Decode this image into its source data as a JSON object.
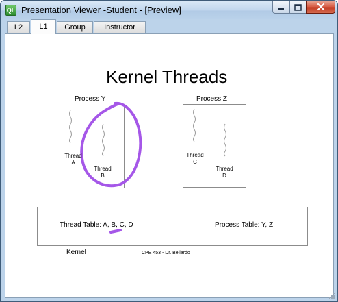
{
  "window": {
    "title": "Presentation Viewer -Student - [Preview]",
    "icon_glyph": "QL"
  },
  "tabs": [
    {
      "label": "L2",
      "active": false
    },
    {
      "label": "L1",
      "active": true
    },
    {
      "label": "Group",
      "active": false
    },
    {
      "label": "Instructor",
      "active": false
    }
  ],
  "slide": {
    "title": "Kernel Threads",
    "process_y": {
      "label": "Process Y",
      "threads": [
        {
          "line1": "Thread",
          "line2": "A"
        },
        {
          "line1": "Thread",
          "line2": "B"
        }
      ]
    },
    "process_z": {
      "label": "Process Z",
      "threads": [
        {
          "line1": "Thread",
          "line2": "C"
        },
        {
          "line1": "Thread",
          "line2": "D"
        }
      ]
    },
    "kernel": {
      "label": "Kernel",
      "thread_table": "Thread Table: A, B, C, D",
      "process_table": "Process Table: Y, Z"
    },
    "footer": "CPE 453 - Dr. Bellardo"
  },
  "annotation_color": "#a557e8"
}
